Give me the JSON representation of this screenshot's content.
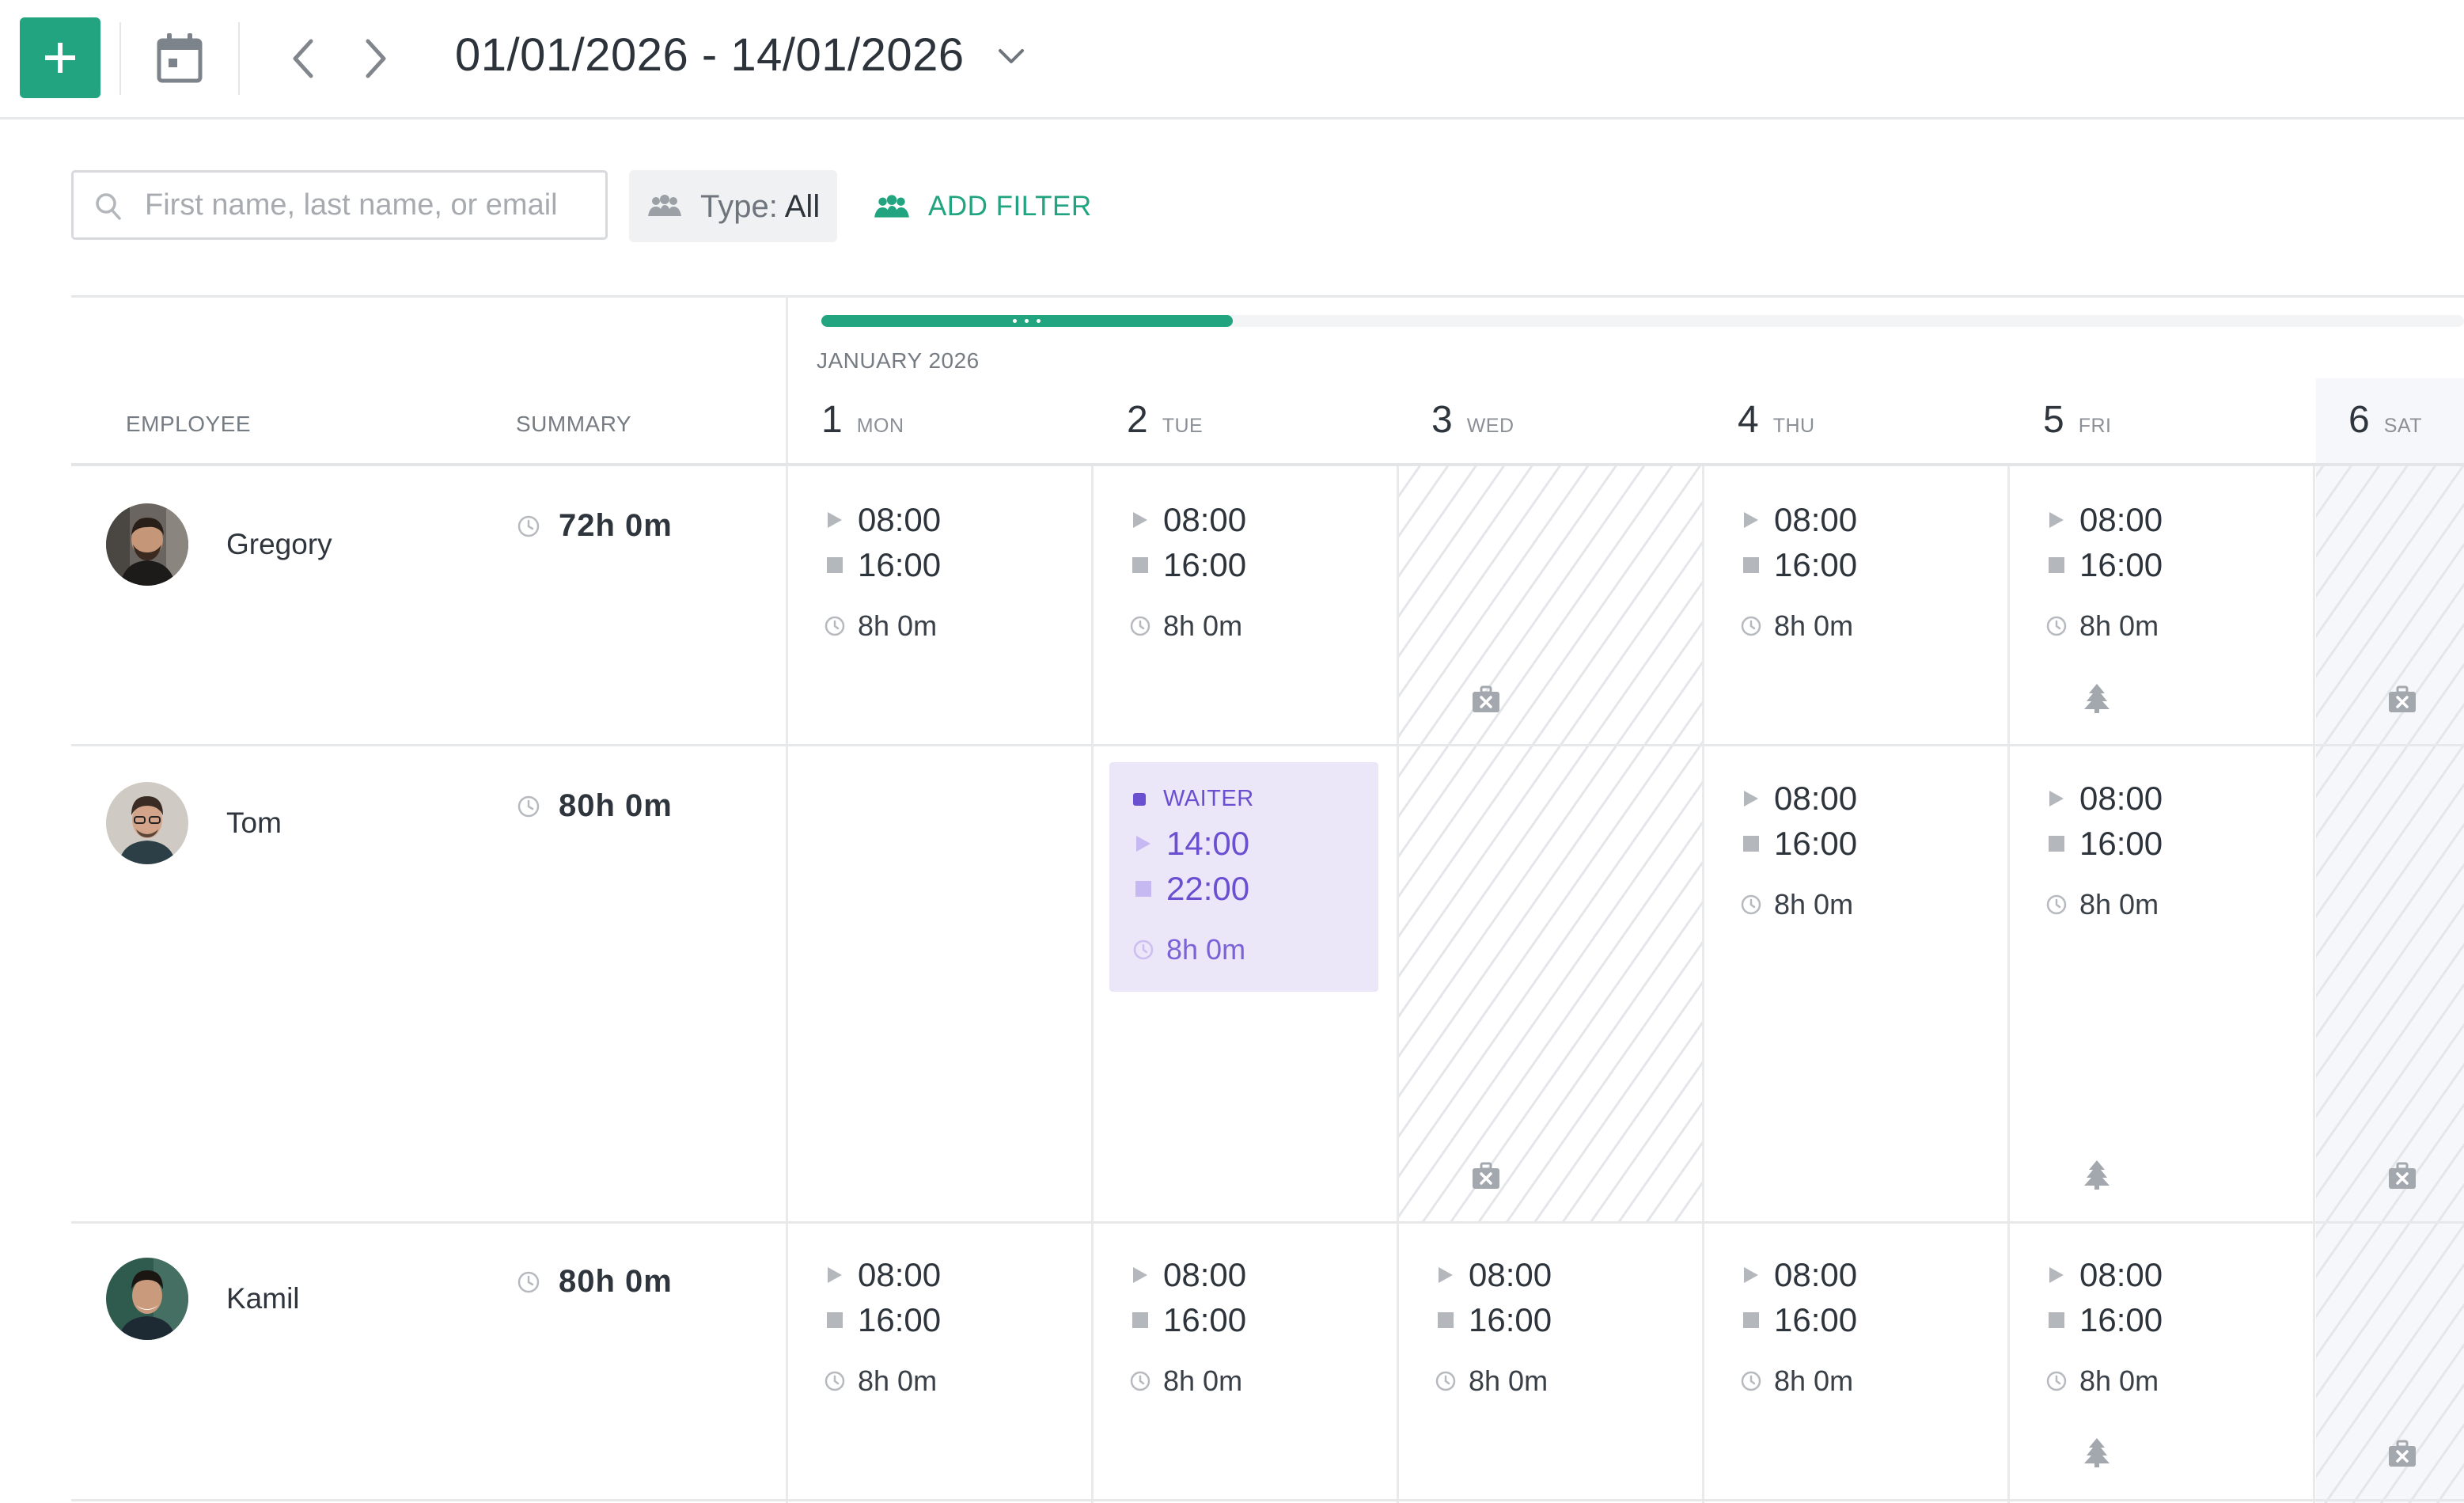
{
  "toolbar": {
    "add_button": "+",
    "date_range": "01/01/2026 - 14/01/2026"
  },
  "filters": {
    "search_placeholder": "First name, last name, or email",
    "type_label": "Type:",
    "type_value": "All",
    "add_filter_label": "ADD FILTER"
  },
  "grid": {
    "employee_header": "EMPLOYEE",
    "summary_header": "SUMMARY",
    "month": "JANUARY 2026",
    "days": [
      {
        "num": "1",
        "name": "MON"
      },
      {
        "num": "2",
        "name": "TUE"
      },
      {
        "num": "3",
        "name": "WED"
      },
      {
        "num": "4",
        "name": "THU"
      },
      {
        "num": "5",
        "name": "FRI"
      },
      {
        "num": "6",
        "name": "SAT"
      }
    ]
  },
  "employees": [
    {
      "name": "Gregory",
      "summary": "72h 0m",
      "shifts": {
        "mon": {
          "start": "08:00",
          "end": "16:00",
          "duration": "8h 0m"
        },
        "tue": {
          "start": "08:00",
          "end": "16:00",
          "duration": "8h 0m"
        },
        "thu": {
          "start": "08:00",
          "end": "16:00",
          "duration": "8h 0m"
        },
        "fri": {
          "start": "08:00",
          "end": "16:00",
          "duration": "8h 0m"
        }
      }
    },
    {
      "name": "Tom",
      "summary": "80h 0m",
      "shifts": {
        "tue": {
          "role": "WAITER",
          "start": "14:00",
          "end": "22:00",
          "duration": "8h 0m"
        },
        "thu": {
          "start": "08:00",
          "end": "16:00",
          "duration": "8h 0m"
        },
        "fri": {
          "start": "08:00",
          "end": "16:00",
          "duration": "8h 0m"
        }
      }
    },
    {
      "name": "Kamil",
      "summary": "80h 0m",
      "shifts": {
        "mon": {
          "start": "08:00",
          "end": "16:00",
          "duration": "8h 0m"
        },
        "tue": {
          "start": "08:00",
          "end": "16:00",
          "duration": "8h 0m"
        },
        "wed": {
          "start": "08:00",
          "end": "16:00",
          "duration": "8h 0m"
        },
        "thu": {
          "start": "08:00",
          "end": "16:00",
          "duration": "8h 0m"
        },
        "fri": {
          "start": "08:00",
          "end": "16:00",
          "duration": "8h 0m"
        }
      }
    }
  ],
  "progress": {
    "percent": 25
  },
  "icons": {
    "sick_leave": "medical-bag-icon",
    "holiday": "tree-icon",
    "clock": "clock-icon"
  },
  "colors": {
    "accent": "#21a47f",
    "role_waiter": "#6b4fd1",
    "role_waiter_bg": "#ece6f9"
  }
}
